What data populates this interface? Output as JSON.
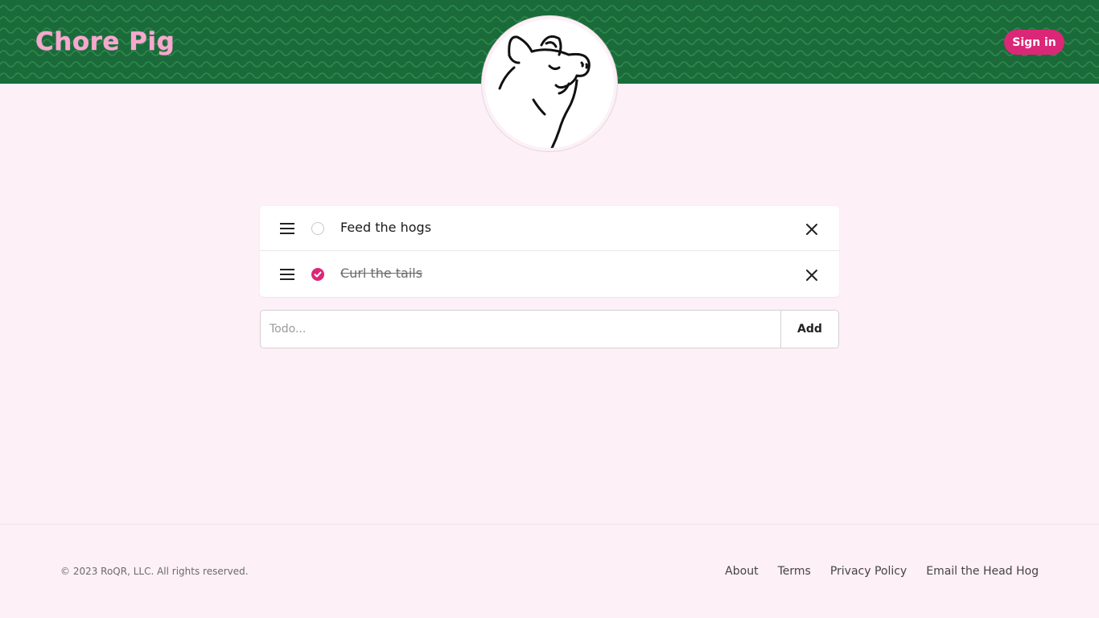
{
  "header": {
    "logo_text": "Chore Pig",
    "signin_label": "Sign in",
    "colors": {
      "background": "#1b6b3a",
      "logo": "#f7a8cf",
      "accent": "#db2777"
    }
  },
  "avatar": {
    "icon": "pig-head-illustration"
  },
  "todos": [
    {
      "text": "Feed the hogs",
      "completed": false
    },
    {
      "text": "Curl the tails",
      "completed": true
    }
  ],
  "add_form": {
    "placeholder": "Todo...",
    "value": "",
    "button_label": "Add"
  },
  "footer": {
    "copyright": "© 2023 RoQR, LLC. All rights reserved.",
    "links": [
      "About",
      "Terms",
      "Privacy Policy",
      "Email the Head Hog"
    ]
  }
}
